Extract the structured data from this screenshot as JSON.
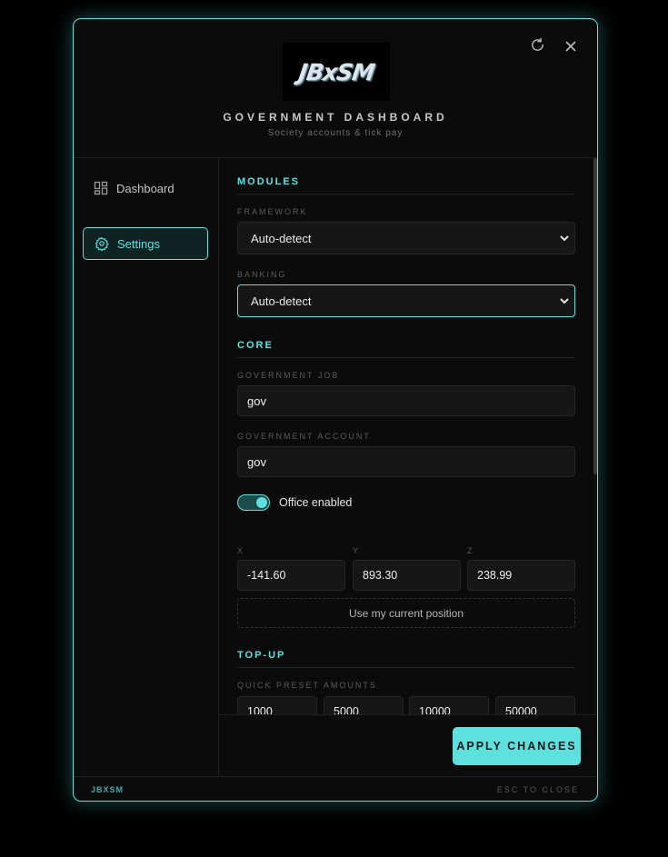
{
  "header": {
    "logo_text": "JBxSM",
    "title": "GOVERNMENT DASHBOARD",
    "subtitle": "Society accounts & tick pay",
    "refresh_icon": "refresh-icon",
    "close_icon": "close-icon"
  },
  "sidebar": {
    "items": [
      {
        "label": "Dashboard",
        "icon": "grid-icon",
        "active": false
      },
      {
        "label": "Settings",
        "icon": "gear-icon",
        "active": true
      }
    ]
  },
  "modules": {
    "section_title": "MODULES",
    "framework_label": "FRAMEWORK",
    "framework_value": "Auto-detect",
    "banking_label": "BANKING",
    "banking_value": "Auto-detect"
  },
  "core": {
    "section_title": "CORE",
    "job_label": "GOVERNMENT JOB",
    "job_value": "gov",
    "account_label": "GOVERNMENT ACCOUNT",
    "account_value": "gov",
    "office_toggle_label": "Office enabled",
    "office_enabled": true,
    "x_label": "X",
    "y_label": "Y",
    "z_label": "Z",
    "x_value": "-141.60",
    "y_value": "893.30",
    "z_value": "238.99",
    "use_position_label": "Use my current position"
  },
  "topup": {
    "section_title": "TOP-UP",
    "presets_label": "QUICK PRESET AMOUNTS",
    "presets": [
      "1000",
      "5000",
      "10000",
      "50000"
    ]
  },
  "actions": {
    "apply_label": "APPLY CHANGES"
  },
  "footer": {
    "brand": "JBXSM",
    "hint": "ESC TO CLOSE"
  },
  "colors": {
    "accent": "#5ee0df",
    "background": "#0b0b0b",
    "input_bg": "#161616"
  }
}
